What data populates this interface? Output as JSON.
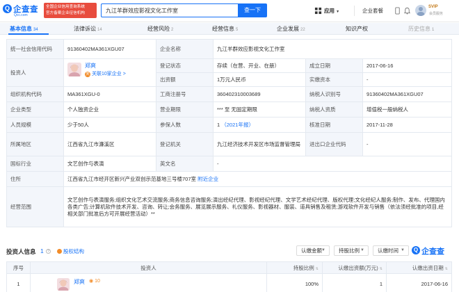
{
  "header": {
    "logo_text": "企查查",
    "logo_sub": "Qcc.com",
    "badge_line1": "全国企业信用查询系统",
    "badge_line2": "官方备案企业征信机构",
    "search_value": "九江羊群效应影视文化工作室",
    "search_button": "查一下",
    "app_label": "应用",
    "suite_label": "企业套餐",
    "svip_label": "SVIP",
    "svip_sub": "会员服务"
  },
  "tabs": [
    {
      "label": "基本信息",
      "count": "34"
    },
    {
      "label": "法律诉讼",
      "count": "14"
    },
    {
      "label": "经营风险",
      "count": "2"
    },
    {
      "label": "经营信息",
      "count": "5"
    },
    {
      "label": "企业发展",
      "count": "22"
    },
    {
      "label": "知识产权",
      "count": ""
    },
    {
      "label": "历史信息",
      "count": "1"
    }
  ],
  "info": {
    "credit_code_label": "统一社会信用代码",
    "credit_code": "91360402MA361XGU07",
    "company_name_label": "企业名称",
    "company_name": "九江羊群效应影视文化工作室",
    "investor_label": "投资人",
    "person_name": "郑爽",
    "person_relation": "关联10家企业",
    "person_relation_arrow": ">",
    "reg_status_label": "登记状态",
    "reg_status": "存续（在营、开业、在册）",
    "established_label": "成立日期",
    "established": "2017-06-16",
    "capital_label": "出资额",
    "capital": "1万元人民币",
    "paid_capital_label": "实缴资本",
    "paid_capital": "-",
    "org_code_label": "组织机构代码",
    "org_code": "MA361XGU-0",
    "biz_reg_label": "工商注册号",
    "biz_reg": "360402310003689",
    "tax_id_label": "纳税人识别号",
    "tax_id": "91360402MA361XGU07",
    "company_type_label": "企业类型",
    "company_type": "个人独资企业",
    "biz_term_label": "营业期限",
    "biz_term": "*** 至 无固定期限",
    "tax_qual_label": "纳税人资质",
    "tax_qual": "增值税一般纳税人",
    "staff_size_label": "人员规模",
    "staff_size": "少于50人",
    "insured_label": "参保人数",
    "insured_value": "1",
    "insured_year": "（2021年报）",
    "approval_label": "核准日期",
    "approval_date": "2017-11-28",
    "region_label": "所属地区",
    "region": "江西省九江市濂溪区",
    "reg_authority_label": "登记机关",
    "reg_authority": "九江经济技术开发区市场监督管理局",
    "import_export_label": "进出口企业代码",
    "import_export": "-",
    "industry_label": "国标行业",
    "industry": "文艺创作与表演",
    "en_name_label": "英文名",
    "en_name": "-",
    "address_label": "住所",
    "address": "江西省九江市经开区新兴产业双创示范基地三号楼707室",
    "nearby_link": "附近企业",
    "scope_label": "经营范围",
    "scope": "文艺创作与表演服务;组织文化艺术交流服务;商务信息咨询服务;演出经纪代理、影视经纪代理、文学艺术经纪代理、版权代理;文化经纪人服务;制作、发布、代理国内各类广告;计算机软件技术开发、咨询、转让;会务服务、展览展示服务、礼仪服务、影视器材、服装、道具销售及租赁;游戏软件开发与销售（依法须经批准的项目,经相关部门批准后方可开展经营活动）**"
  },
  "investors": {
    "title": "投资人信息",
    "count": "1",
    "structure_link": "股权结构",
    "filter_capital": "认缴金额",
    "filter_ratio": "持股比例",
    "filter_more": "认缴时间",
    "watermark_text": "企查查",
    "columns": [
      "序号",
      "投资人",
      "持股比例",
      "认缴出资额(万元)",
      "认缴出资日期"
    ],
    "rows": [
      {
        "index": "1",
        "name": "郑爽",
        "tag": "10",
        "ratio": "100%",
        "amount": "1",
        "date": "2017-06-16"
      }
    ]
  }
}
